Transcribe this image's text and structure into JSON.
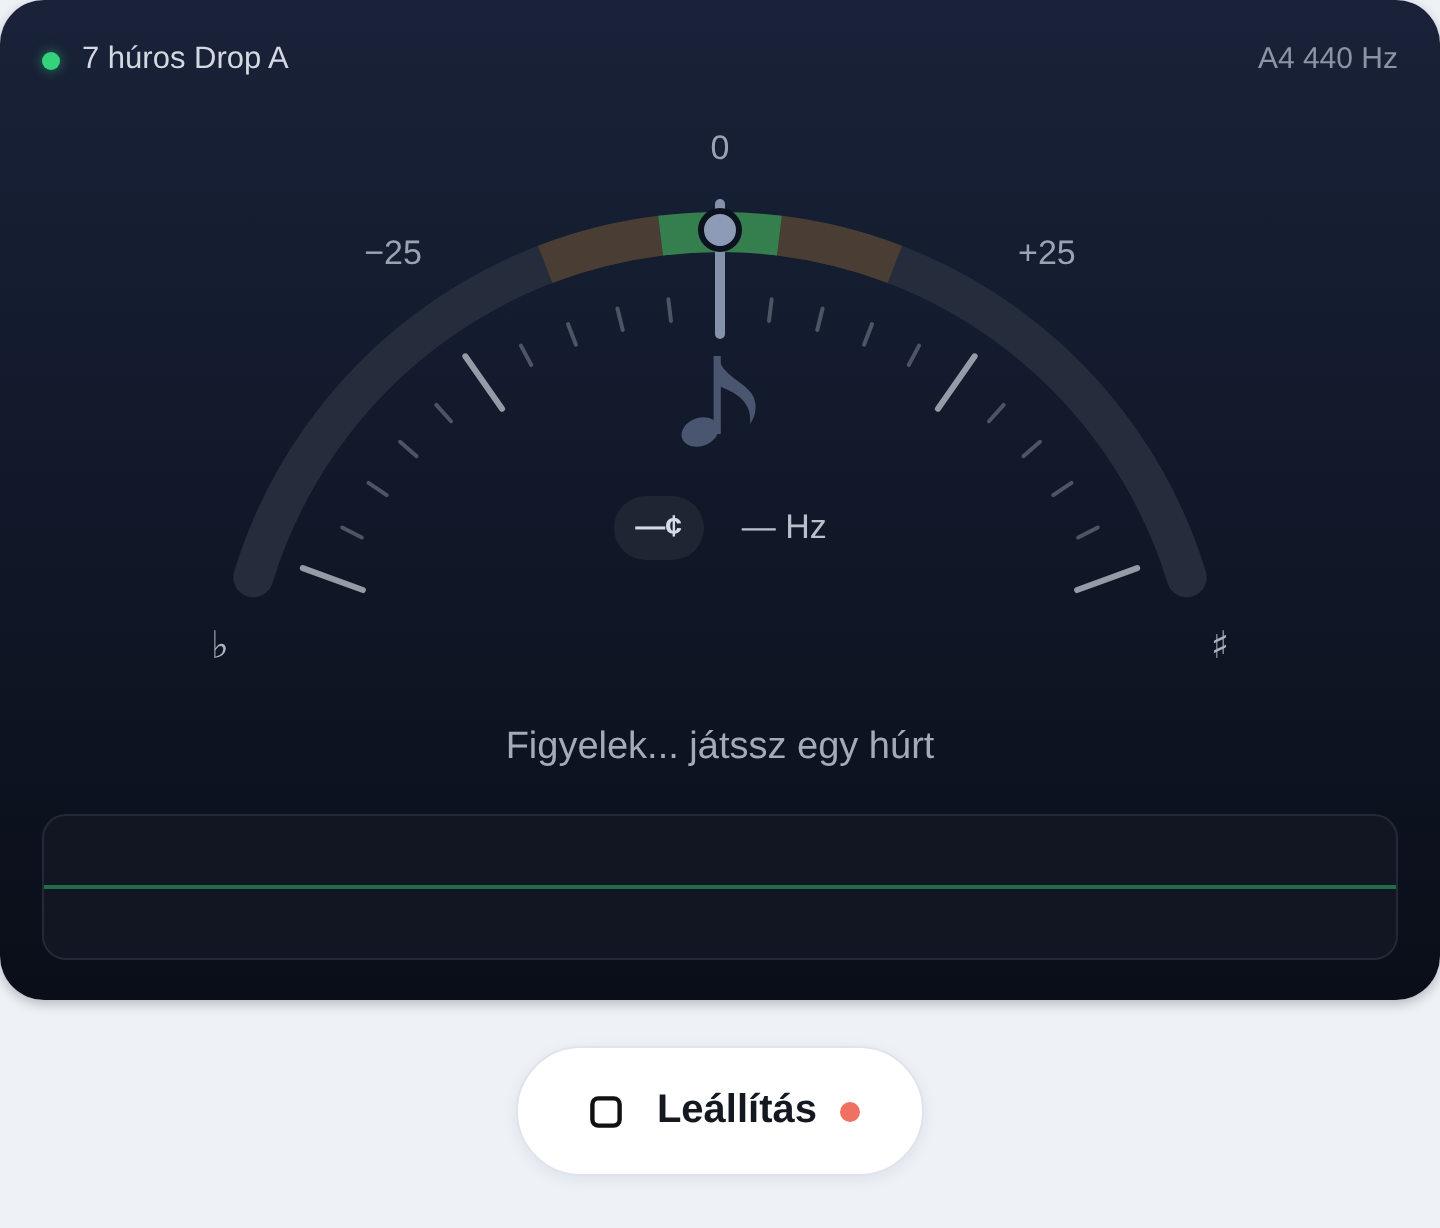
{
  "tuning": {
    "name": "7 húros Drop A",
    "active": true
  },
  "reference": "A4 440 Hz",
  "gauge": {
    "minus_label": "−25",
    "zero_label": "0",
    "plus_label": "+25",
    "flat": "♭",
    "sharp": "♯",
    "level": 0.5
  },
  "readout": {
    "cents": "—¢",
    "frequency": "— Hz"
  },
  "status": "Figyelek... játssz egy húrt",
  "stop_button": {
    "label": "Leállítás",
    "recording": true
  }
}
